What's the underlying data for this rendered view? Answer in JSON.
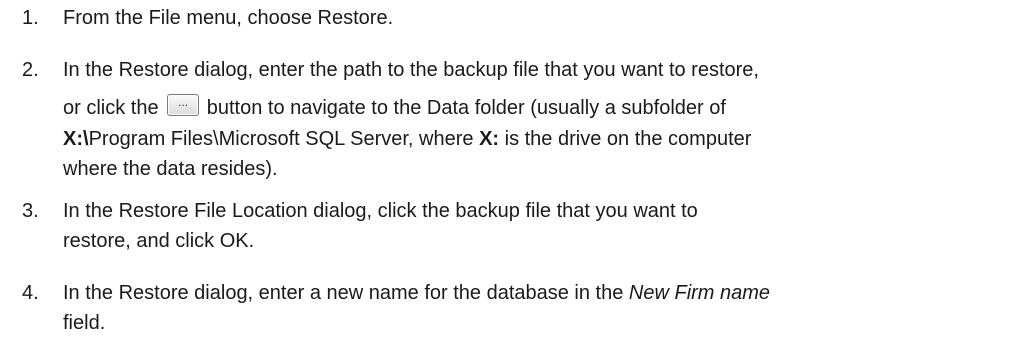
{
  "steps": [
    {
      "number": "1.",
      "text": "From the File menu, choose Restore."
    },
    {
      "number": "2.",
      "line1": "In the Restore dialog, enter the path to the backup file that you want to restore,",
      "line2_before": "or click the",
      "button_label": "...",
      "line2_after": "button to navigate to the Data folder (usually a subfolder of",
      "line3_bold": "X:\\",
      "line3_rest": "Program Files\\Microsoft SQL Server, where ",
      "line3_bold2": "X:",
      "line3_end": " is the drive on the computer",
      "line4": "where the data resides)."
    },
    {
      "number": "3.",
      "line1": "In the Restore File Location dialog, click the backup file that you want to",
      "line2": "restore, and click OK."
    },
    {
      "number": "4.",
      "line1_before": "In the Restore dialog, enter a new name for the database in the ",
      "line1_italic": "New Firm name",
      "line2": "field."
    }
  ]
}
